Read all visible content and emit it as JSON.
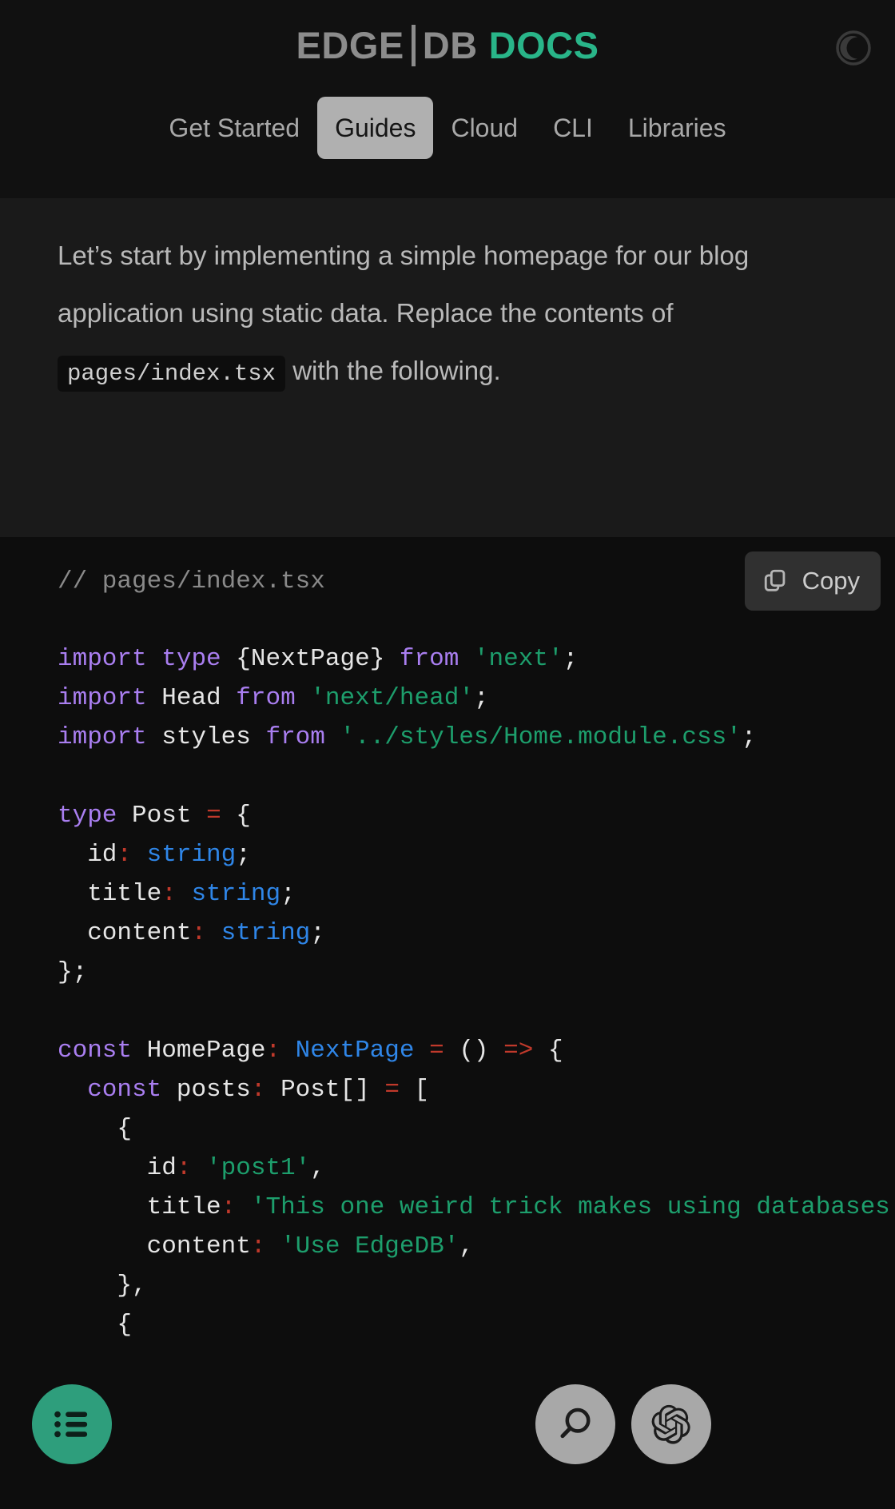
{
  "header": {
    "brand": {
      "edge": "EDGE",
      "db": "DB",
      "docs": "DOCS"
    },
    "theme_toggle_icon": "moon-icon",
    "accent_color": "#29b589",
    "nav_tabs": [
      {
        "label": "Get Started",
        "active": false
      },
      {
        "label": "Guides",
        "active": true
      },
      {
        "label": "Cloud",
        "active": false
      },
      {
        "label": "CLI",
        "active": false
      },
      {
        "label": "Libraries",
        "active": false
      }
    ]
  },
  "prose": {
    "part1": "Let’s start by implementing a simple homepage for our blog application using static data. Replace the contents of ",
    "inline_code": "pages/index.tsx",
    "part2": " with the following."
  },
  "code_block": {
    "filename_comment": "// pages/index.tsx",
    "copy_label": "Copy",
    "copy_icon": "copy-icon",
    "language": "tsx",
    "lines": [
      "import type {NextPage} from 'next';",
      "import Head from 'next/head';",
      "import styles from '../styles/Home.module.css';",
      "",
      "type Post = {",
      "  id: string;",
      "  title: string;",
      "  content: string;",
      "};",
      "",
      "const HomePage: NextPage = () => {",
      "  const posts: Post[] = [",
      "    {",
      "      id: 'post1',",
      "      title: 'This one weird trick makes using databases fun',",
      "      content: 'Use EdgeDB',",
      "    },",
      "    {"
    ]
  },
  "floating_buttons": [
    {
      "name": "menu",
      "icon": "list-menu-icon",
      "color": "#2e9e7c"
    },
    {
      "name": "search",
      "icon": "search-icon",
      "color": "#a8a8a8"
    },
    {
      "name": "ai-assistant",
      "icon": "openai-logo-icon",
      "color": "#a8a8a8"
    }
  ]
}
